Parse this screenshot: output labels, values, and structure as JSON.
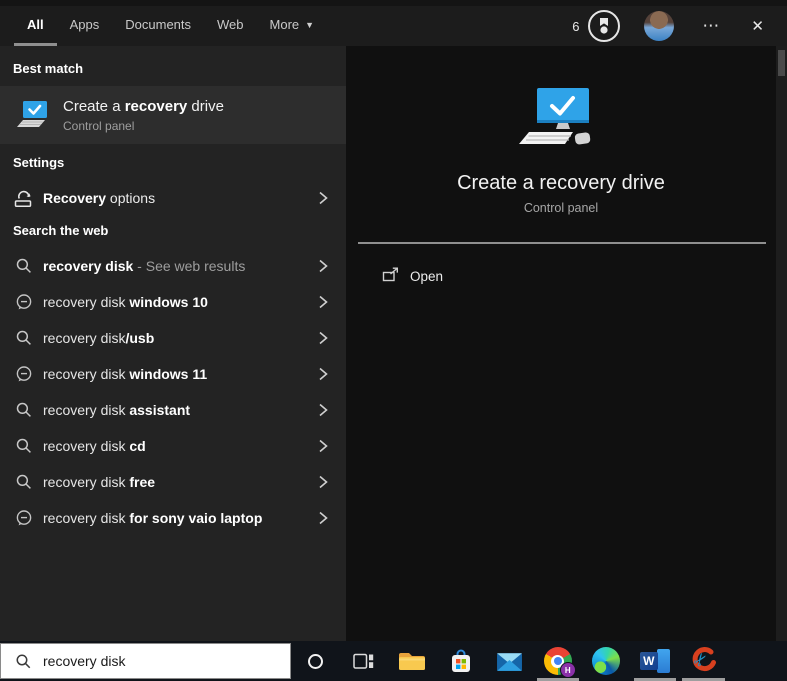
{
  "tabs": {
    "items": [
      {
        "label": "All"
      },
      {
        "label": "Apps"
      },
      {
        "label": "Documents"
      },
      {
        "label": "Web"
      },
      {
        "label": "More"
      }
    ],
    "selected": "All",
    "rewards_count": "6"
  },
  "left_panel": {
    "best_match_header": "Best match",
    "best_match": {
      "title_pre": "Create a ",
      "title_strong": "recovery",
      "title_post": " drive",
      "subtitle": "Control panel"
    },
    "settings_header": "Settings",
    "settings_item": {
      "strong": "Recovery",
      "post": " options"
    },
    "web_header": "Search the web",
    "web_rows": [
      {
        "icon": "search",
        "pre": "",
        "strong": "recovery disk",
        "post": " - See web results"
      },
      {
        "icon": "trending",
        "pre": "recovery disk ",
        "strong": "windows 10",
        "post": ""
      },
      {
        "icon": "search",
        "pre": "recovery disk",
        "strong": "/usb",
        "post": ""
      },
      {
        "icon": "trending",
        "pre": "recovery disk ",
        "strong": "windows 11",
        "post": ""
      },
      {
        "icon": "search",
        "pre": "recovery disk ",
        "strong": "assistant",
        "post": ""
      },
      {
        "icon": "search",
        "pre": "recovery disk ",
        "strong": "cd",
        "post": ""
      },
      {
        "icon": "search",
        "pre": "recovery disk ",
        "strong": "free",
        "post": ""
      },
      {
        "icon": "trending",
        "pre": "recovery disk ",
        "strong": "for sony vaio laptop",
        "post": ""
      }
    ]
  },
  "preview": {
    "title": "Create a recovery drive",
    "subtitle": "Control panel",
    "open_label": "Open",
    "word_letter": "W",
    "chrome_badge_letter": "H"
  },
  "taskbar": {
    "search_value": "recovery disk",
    "icons": [
      "search",
      "cortana",
      "task-view",
      "file-explorer",
      "microsoft-store",
      "mail",
      "chrome",
      "edge",
      "word",
      "screen-capture-tool"
    ],
    "running_indicators": [
      "chrome",
      "word",
      "screen-capture-tool"
    ]
  },
  "colors": {
    "accent_blue": "#2fa3e8",
    "left_panel_bg": "#232323",
    "right_panel_bg": "#101010",
    "highlight_row_bg": "#2d2d2d",
    "taskbar_bg": "#10141a"
  }
}
